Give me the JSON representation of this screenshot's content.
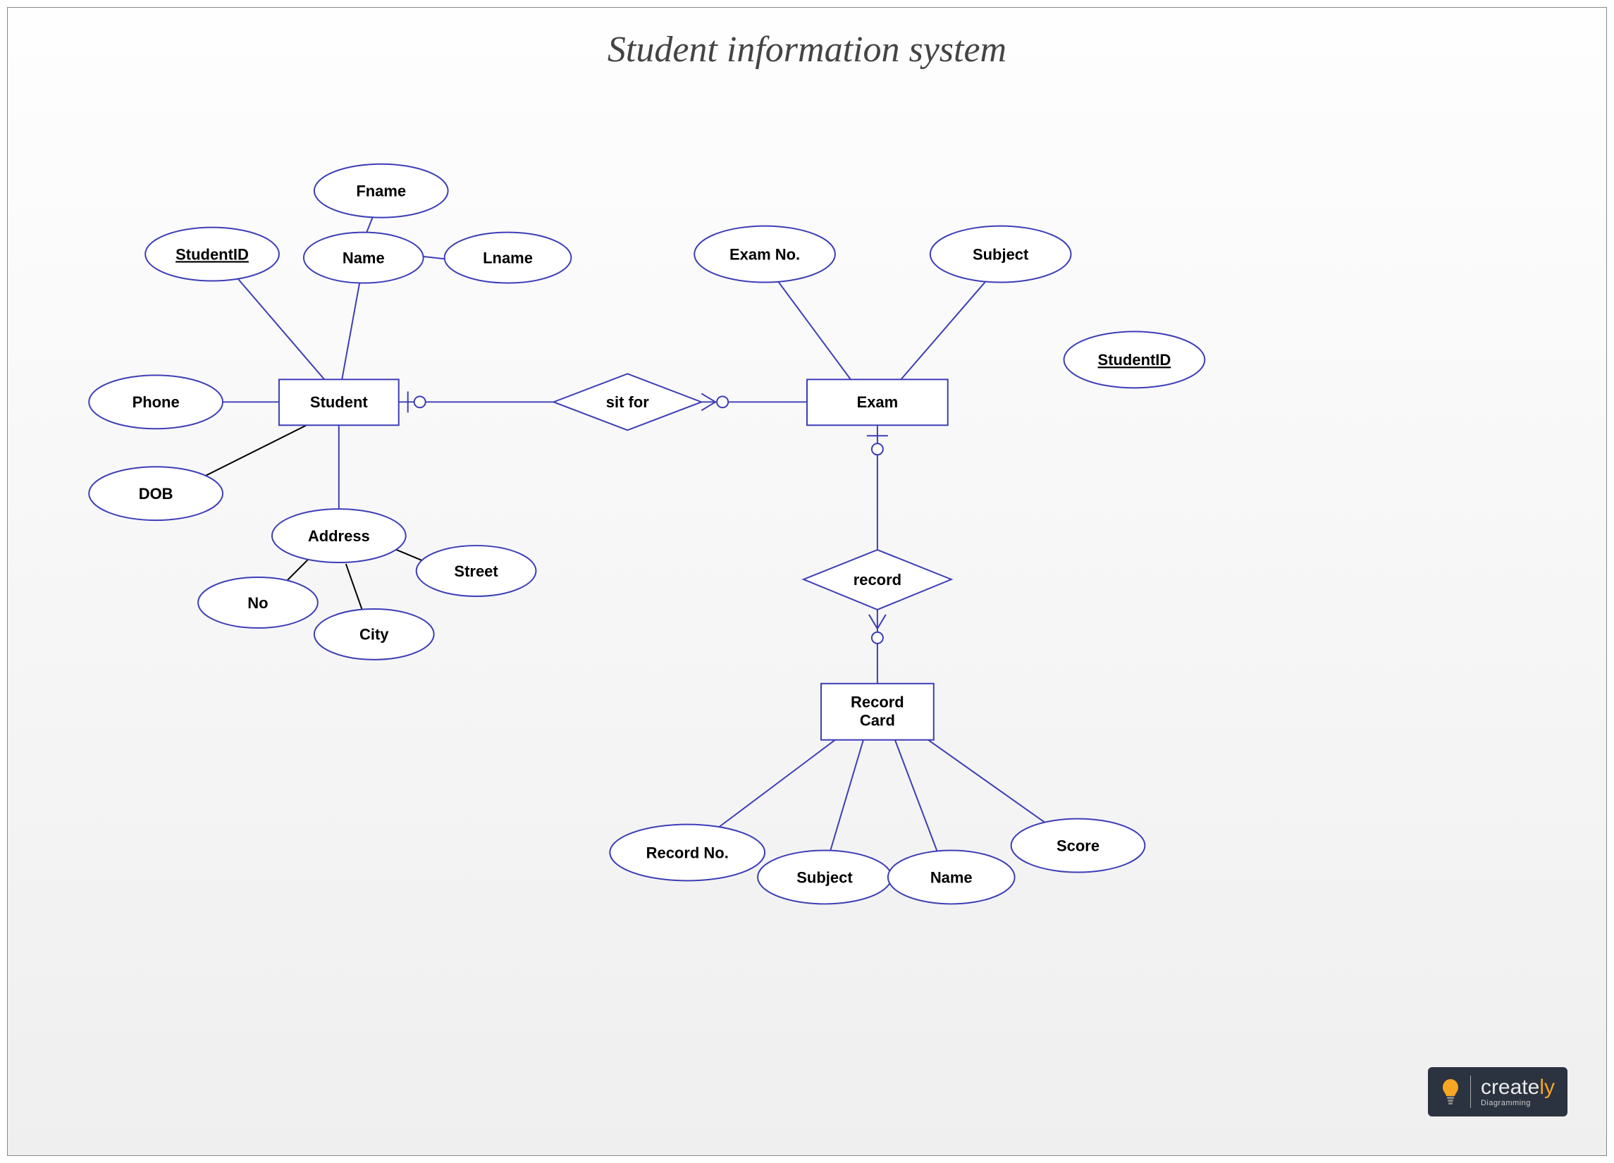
{
  "title": "Student information system",
  "entities": {
    "student": "Student",
    "exam": "Exam",
    "record_card": "Record\nCard"
  },
  "relationships": {
    "sit_for": "sit for",
    "record": "record"
  },
  "attributes": {
    "student_id": "StudentID",
    "phone": "Phone",
    "dob": "DOB",
    "name": "Name",
    "fname": "Fname",
    "lname": "Lname",
    "address": "Address",
    "no": "No",
    "city": "City",
    "street": "Street",
    "exam_no": "Exam No.",
    "subject_exam": "Subject",
    "student_id_exam": "StudentID",
    "record_no": "Record No.",
    "rc_subject": "Subject",
    "rc_name": "Name",
    "rc_score": "Score"
  },
  "logo": {
    "brand_left": "create",
    "brand_right": "ly",
    "tagline": "Diagramming"
  }
}
